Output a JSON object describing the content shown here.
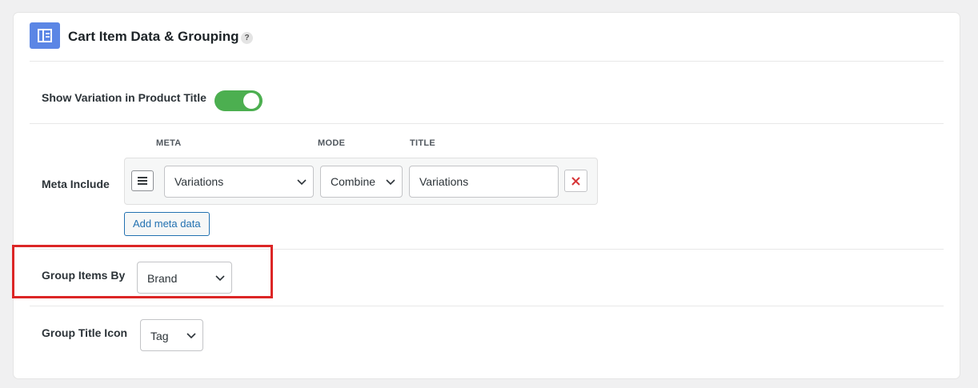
{
  "section": {
    "title": "Cart Item Data & Grouping",
    "help": "?"
  },
  "show_variation": {
    "label": "Show Variation in Product Title",
    "enabled": true
  },
  "meta_include": {
    "label": "Meta Include",
    "columns": {
      "meta": "META",
      "mode": "MODE",
      "title": "TITLE"
    },
    "rows": [
      {
        "meta": "Variations",
        "mode": "Combine",
        "title": "Variations"
      }
    ],
    "add_button": "Add meta data"
  },
  "group_items_by": {
    "label": "Group Items By",
    "value": "Brand"
  },
  "group_title_icon": {
    "label": "Group Title Icon",
    "value": "Tag"
  },
  "colors": {
    "accent": "#5b86e5",
    "toggle_on": "#4caf50",
    "link": "#2271b1",
    "highlight": "#dc2626",
    "remove": "#d63638"
  }
}
